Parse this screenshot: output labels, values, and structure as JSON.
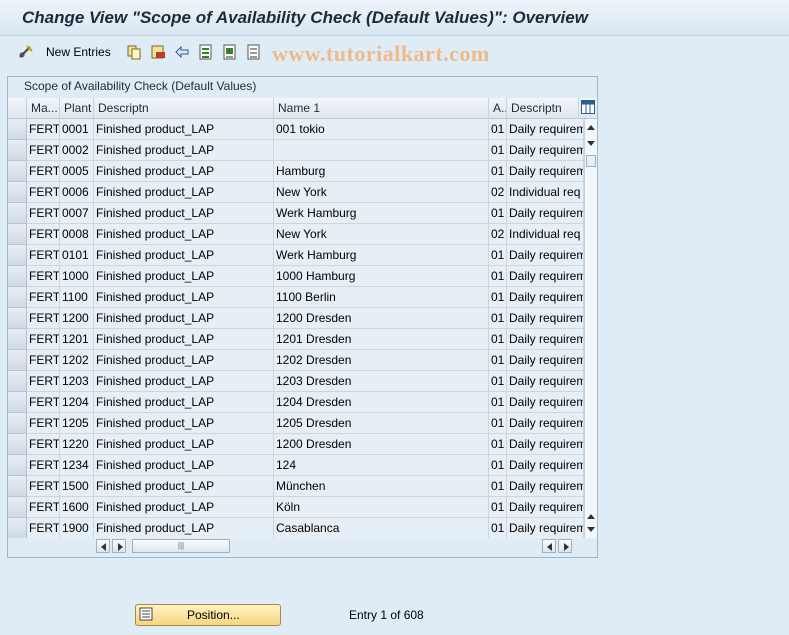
{
  "window": {
    "title": "Change View \"Scope of Availability Check (Default Values)\": Overview"
  },
  "toolbar": {
    "new_entries_label": "New Entries",
    "icons": [
      "edit-glasses-icon",
      "copy-icon",
      "delete-icon",
      "undo-icon",
      "select-all-icon",
      "select-block-icon",
      "deselect-all-icon"
    ]
  },
  "watermark": "www.tutorialkart.com",
  "table": {
    "title": "Scope of Availability Check (Default Values)",
    "columns": [
      "Ma...",
      "Plant",
      "Descriptn",
      "Name 1",
      "A..",
      "Descriptn"
    ],
    "rows": [
      [
        "FERT",
        "0001",
        "Finished product_LAP",
        "001 tokio",
        "01",
        "Daily requirem"
      ],
      [
        "FERT",
        "0002",
        "Finished product_LAP",
        "",
        "01",
        "Daily requirem"
      ],
      [
        "FERT",
        "0005",
        "Finished product_LAP",
        "Hamburg",
        "01",
        "Daily requirem"
      ],
      [
        "FERT",
        "0006",
        "Finished product_LAP",
        "New York",
        "02",
        "Individual req"
      ],
      [
        "FERT",
        "0007",
        "Finished product_LAP",
        "Werk Hamburg",
        "01",
        "Daily requirem"
      ],
      [
        "FERT",
        "0008",
        "Finished product_LAP",
        "New York",
        "02",
        "Individual req"
      ],
      [
        "FERT",
        "0101",
        "Finished product_LAP",
        "Werk Hamburg",
        "01",
        "Daily requirem"
      ],
      [
        "FERT",
        "1000",
        "Finished product_LAP",
        "1000 Hamburg",
        "01",
        "Daily requirem"
      ],
      [
        "FERT",
        "1100",
        "Finished product_LAP",
        "1100 Berlin",
        "01",
        "Daily requirem"
      ],
      [
        "FERT",
        "1200",
        "Finished product_LAP",
        "1200 Dresden",
        "01",
        "Daily requirem"
      ],
      [
        "FERT",
        "1201",
        "Finished product_LAP",
        "1201 Dresden",
        "01",
        "Daily requirem"
      ],
      [
        "FERT",
        "1202",
        "Finished product_LAP",
        "1202 Dresden",
        "01",
        "Daily requirem"
      ],
      [
        "FERT",
        "1203",
        "Finished product_LAP",
        "1203 Dresden",
        "01",
        "Daily requirem"
      ],
      [
        "FERT",
        "1204",
        "Finished product_LAP",
        "1204 Dresden",
        "01",
        "Daily requirem"
      ],
      [
        "FERT",
        "1205",
        "Finished product_LAP",
        "1205 Dresden",
        "01",
        "Daily requirem"
      ],
      [
        "FERT",
        "1220",
        "Finished product_LAP",
        "1200 Dresden",
        "01",
        "Daily requirem"
      ],
      [
        "FERT",
        "1234",
        "Finished product_LAP",
        "124",
        "01",
        "Daily requirem"
      ],
      [
        "FERT",
        "1500",
        "Finished product_LAP",
        "München",
        "01",
        "Daily requirem"
      ],
      [
        "FERT",
        "1600",
        "Finished product_LAP",
        "Köln",
        "01",
        "Daily requirem"
      ],
      [
        "FERT",
        "1900",
        "Finished product_LAP",
        "Casablanca",
        "01",
        "Daily requirem"
      ]
    ]
  },
  "footer": {
    "position_button": "Position...",
    "entry_info": "Entry 1 of 608"
  }
}
